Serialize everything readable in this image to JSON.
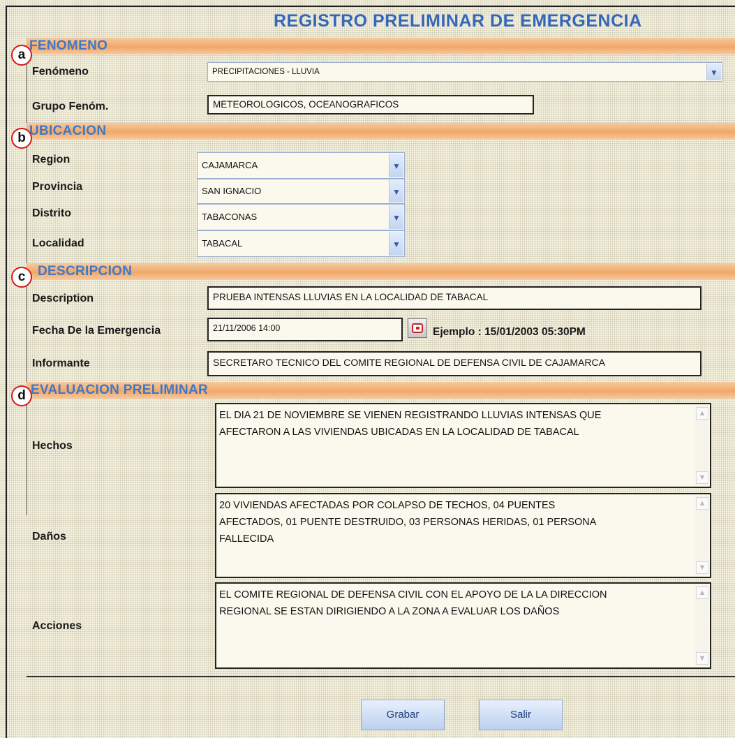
{
  "title": "REGISTRO PRELIMINAR DE EMERGENCIA",
  "sections": {
    "fenomeno": {
      "badge": "a",
      "title": "FENOMENO"
    },
    "ubicacion": {
      "badge": "b",
      "title": "UBICACION"
    },
    "descripcion": {
      "badge": "c",
      "title": "DESCRIPCION"
    },
    "evaluacion": {
      "badge": "d",
      "title": "EVALUACION PRELIMINAR"
    }
  },
  "fenomeno": {
    "label": "Fenómeno",
    "value": "PRECIPITACIONES - LLUVIA",
    "grupo_label": "Grupo Fenóm.",
    "grupo_value": "METEOROLOGICOS, OCEANOGRAFICOS"
  },
  "ubicacion": {
    "region_label": "Region",
    "region_value": "CAJAMARCA",
    "provincia_label": "Provincia",
    "provincia_value": "SAN IGNACIO",
    "distrito_label": "Distrito",
    "distrito_value": "TABACONAS",
    "localidad_label": "Localidad",
    "localidad_value": "TABACAL"
  },
  "descripcion": {
    "description_label": "Description",
    "description_value": "PRUEBA INTENSAS LLUVIAS EN LA LOCALIDAD DE TABACAL",
    "fecha_label": "Fecha De la Emergencia",
    "fecha_value": "21/11/2006 14:00",
    "fecha_example": "Ejemplo : 15/01/2003 05:30PM",
    "informante_label": "Informante",
    "informante_value": "SECRETARO TECNICO DEL COMITE REGIONAL DE DEFENSA CIVIL DE CAJAMARCA"
  },
  "evaluacion": {
    "hechos_label": "Hechos",
    "hechos_lines": [
      "EL DIA 21 DE NOVIEMBRE SE VIENEN REGISTRANDO LLUVIAS INTENSAS QUE",
      "AFECTARON A LAS VIVIENDAS UBICADAS EN LA LOCALIDAD DE TABACAL"
    ],
    "danos_label": "Daños",
    "danos_lines": [
      "20 VIVIENDAS AFECTADAS POR COLAPSO DE TECHOS, 04 PUENTES",
      "AFECTADOS, 01 PUENTE DESTRUIDO, 03 PERSONAS HERIDAS, 01 PERSONA",
      "FALLECIDA"
    ],
    "acciones_label": "Acciones",
    "acciones_lines": [
      "EL COMITE REGIONAL DE DEFENSA CIVIL CON EL APOYO DE LA LA DIRECCION",
      "REGIONAL SE ESTAN DIRIGIENDO A LA ZONA A EVALUAR LOS DAÑOS"
    ]
  },
  "buttons": {
    "grabar": "Grabar",
    "salir": "Salir"
  },
  "icons": {
    "select_arrow": "chevron-down-icon",
    "calendar": "calendar-icon"
  },
  "colors": {
    "title": "#3567b8",
    "section_bar": "#f1a868",
    "badge_border": "#d51a1a"
  }
}
